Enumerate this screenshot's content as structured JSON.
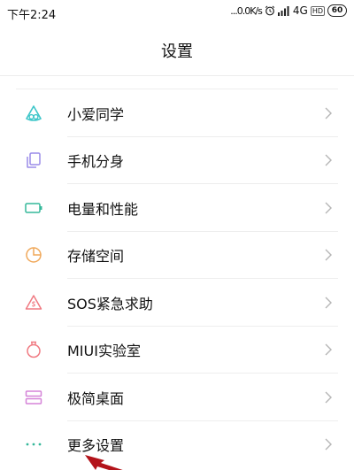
{
  "status_bar": {
    "time": "下午2:24",
    "network_speed": "...0.0K/s",
    "network_type": "4G",
    "hd_label": "HD",
    "battery": "60"
  },
  "header": {
    "title": "设置"
  },
  "settings": [
    {
      "label": "小爱同学",
      "icon": "xiaoai-icon",
      "color": "#3ec6c9"
    },
    {
      "label": "手机分身",
      "icon": "dual-phone-icon",
      "color": "#9a8be8"
    },
    {
      "label": "电量和性能",
      "icon": "battery-icon",
      "color": "#35b89a"
    },
    {
      "label": "存储空间",
      "icon": "storage-pie-icon",
      "color": "#f0a85a"
    },
    {
      "label": "SOS紧急求助",
      "icon": "sos-icon",
      "color": "#f07a82"
    },
    {
      "label": "MIUI实验室",
      "icon": "lab-flask-icon",
      "color": "#f07a82"
    },
    {
      "label": "极简桌面",
      "icon": "simple-desktop-icon",
      "color": "#d583d8"
    },
    {
      "label": "更多设置",
      "icon": "more-dots-icon",
      "color": "#35b89a"
    }
  ],
  "colors": {
    "annotation_arrow": "#b3131a"
  }
}
